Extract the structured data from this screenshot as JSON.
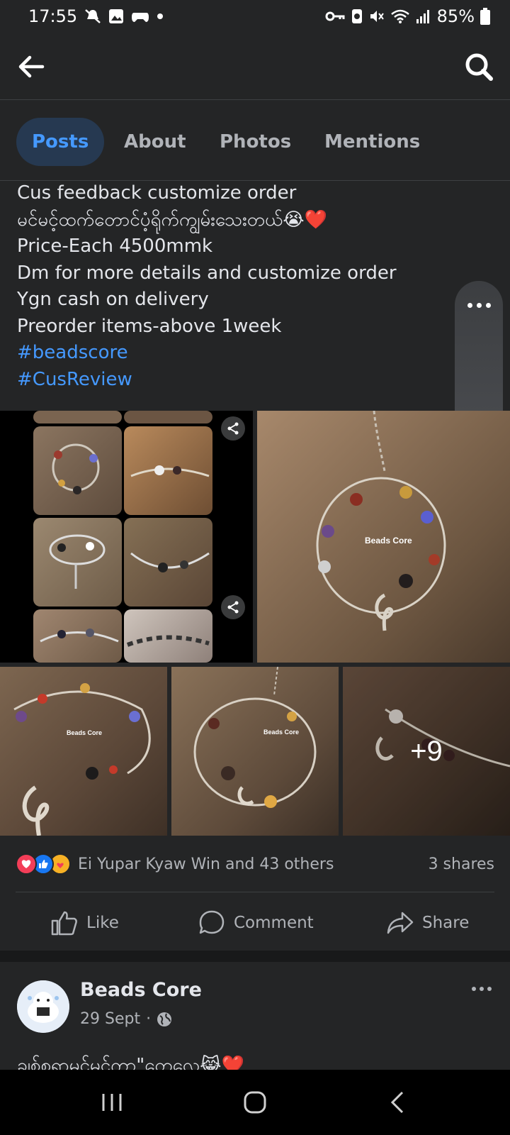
{
  "status_bar": {
    "time": "17:55",
    "battery": "85%"
  },
  "tabs": [
    {
      "label": "Posts",
      "active": true
    },
    {
      "label": "About"
    },
    {
      "label": "Photos"
    },
    {
      "label": "Mentions"
    }
  ],
  "post": {
    "lines": [
      "Cus feedback customize order",
      "မင်မင့်ထက်တောင်ပံ့ရိုက်ကျွမ်းသေးတယ်😭❤️",
      "Price-Each 4500mmk",
      "Dm for more details and customize order",
      "Ygn cash on delivery",
      "Preorder items-above 1week"
    ],
    "hashtags": [
      "#beadscore",
      "#CusReview"
    ],
    "watermark": "Beads Core",
    "more_photos": "+9",
    "reactions_text": "Ei Yupar Kyaw Win and 43 others",
    "shares": "3 shares",
    "actions": {
      "like": "Like",
      "comment": "Comment",
      "share": "Share"
    }
  },
  "next_post": {
    "page_name": "Beads Core",
    "date": "29 Sept",
    "text": "ချစ်စရာမင်မင်ကာ\"တေလေ😹❤️"
  },
  "icons": {
    "back": "arrow-left-icon",
    "search": "search-icon",
    "more": "more-icon",
    "mute": "mute-icon",
    "globe": "globe-icon"
  },
  "colors": {
    "background": "#242526",
    "accent": "#4599ff",
    "active_tab_bg": "#263951",
    "text": "#e4e6eb",
    "muted_text": "#b0b3b8"
  }
}
